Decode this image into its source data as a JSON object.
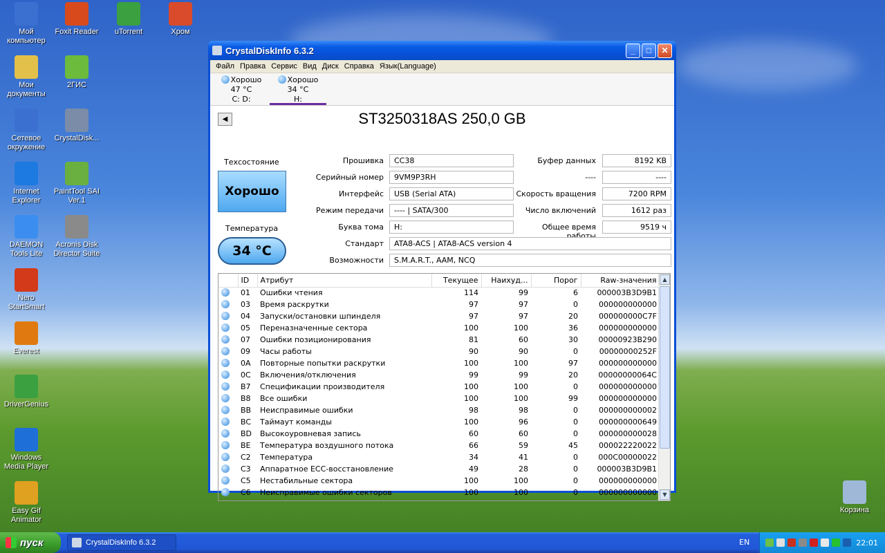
{
  "desktop": {
    "icons": [
      {
        "label": "Мой компьютер",
        "icon": "my-computer-icon",
        "color": "#3b6fd0"
      },
      {
        "label": "Мои документы",
        "icon": "my-documents-icon",
        "color": "#e3c04a"
      },
      {
        "label": "Сетевое окружение",
        "icon": "network-icon",
        "color": "#3b6fd0"
      },
      {
        "label": "Internet Explorer",
        "icon": "ie-icon",
        "color": "#1d7ae0"
      },
      {
        "label": "DAEMON Tools Lite",
        "icon": "daemon-tools-icon",
        "color": "#3b8ef0"
      },
      {
        "label": "Nero StartSmart",
        "icon": "nero-icon",
        "color": "#d23a1a"
      },
      {
        "label": "Everest",
        "icon": "everest-icon",
        "color": "#e07a10"
      },
      {
        "label": "DriverGenius",
        "icon": "driver-genius-icon",
        "color": "#3aa040"
      },
      {
        "label": "Windows Media Player",
        "icon": "media-player-icon",
        "color": "#1f6fd8"
      },
      {
        "label": "Easy Gif Animator",
        "icon": "gif-animator-icon",
        "color": "#e0a020"
      },
      {
        "label": "Foxit Reader",
        "icon": "foxit-icon",
        "color": "#d84a1c"
      },
      {
        "label": "2ГИС",
        "icon": "2gis-icon",
        "color": "#6cbb3c"
      },
      {
        "label": "CrystalDisk...",
        "icon": "crystaldisk-icon",
        "color": "#7a8ca8"
      },
      {
        "label": "PaintTool SAI Ver.1",
        "icon": "painttool-icon",
        "color": "#6ab040"
      },
      {
        "label": "Acronis Disk Director Suite",
        "icon": "acronis-icon",
        "color": "#8a8a8a"
      },
      {
        "label": "uTorrent",
        "icon": "utorrent-icon",
        "color": "#3aa040"
      },
      {
        "label": "Хром",
        "icon": "chrome-icon",
        "color": "#d94b2b"
      },
      {
        "label": "Корзина",
        "icon": "recycle-bin-icon",
        "color": "#9fb8d8"
      }
    ]
  },
  "window": {
    "title": "CrystalDiskInfo 6.3.2",
    "menu": [
      "Файл",
      "Правка",
      "Сервис",
      "Вид",
      "Диск",
      "Справка",
      "Язык(Language)"
    ],
    "disk_tabs": [
      {
        "status": "Хорошо",
        "temp": "47 °C",
        "drive": "C: D:"
      },
      {
        "status": "Хорошо",
        "temp": "34 °C",
        "drive": "H:"
      }
    ],
    "model": "ST3250318AS 250,0 GB",
    "health_label": "Техсостояние",
    "health_value": "Хорошо",
    "temp_label": "Температура",
    "temp_value": "34 °C",
    "info_left": [
      {
        "label": "Прошивка",
        "value": "CC38"
      },
      {
        "label": "Серийный номер",
        "value": "9VM9P3RH"
      },
      {
        "label": "Интерфейс",
        "value": "USB (Serial ATA)"
      },
      {
        "label": "Режим передачи",
        "value": "---- | SATA/300"
      },
      {
        "label": "Буква тома",
        "value": "H:"
      }
    ],
    "info_right": [
      {
        "label": "Буфер данных",
        "value": "8192 KB"
      },
      {
        "label": "----",
        "value": "----"
      },
      {
        "label": "Скорость вращения",
        "value": "7200 RPM"
      },
      {
        "label": "Число включений",
        "value": "1612 раз"
      },
      {
        "label": "Общее время работы",
        "value": "9519 ч"
      }
    ],
    "standard_label": "Стандарт",
    "standard_value": "ATA8-ACS | ATA8-ACS version 4",
    "features_label": "Возможности",
    "features_value": "S.M.A.R.T., AAM, NCQ",
    "smart_headers": [
      "",
      "ID",
      "Атрибут",
      "Текущее",
      "Наихуд...",
      "Порог",
      "Raw-значения"
    ],
    "smart_rows": [
      [
        "01",
        "Ошибки чтения",
        "114",
        "99",
        "6",
        "000003B3D9B1"
      ],
      [
        "03",
        "Время раскрутки",
        "97",
        "97",
        "0",
        "000000000000"
      ],
      [
        "04",
        "Запуски/остановки шпинделя",
        "97",
        "97",
        "20",
        "000000000C7F"
      ],
      [
        "05",
        "Переназначенные сектора",
        "100",
        "100",
        "36",
        "000000000000"
      ],
      [
        "07",
        "Ошибки позиционирования",
        "81",
        "60",
        "30",
        "00000923B290"
      ],
      [
        "09",
        "Часы работы",
        "90",
        "90",
        "0",
        "00000000252F"
      ],
      [
        "0A",
        "Повторные попытки раскрутки",
        "100",
        "100",
        "97",
        "000000000000"
      ],
      [
        "0C",
        "Включения/отключения",
        "99",
        "99",
        "20",
        "00000000064C"
      ],
      [
        "B7",
        "Спецификации производителя",
        "100",
        "100",
        "0",
        "000000000000"
      ],
      [
        "B8",
        "Все ошибки",
        "100",
        "100",
        "99",
        "000000000000"
      ],
      [
        "BB",
        "Неисправимые ошибки",
        "98",
        "98",
        "0",
        "000000000002"
      ],
      [
        "BC",
        "Таймаут команды",
        "100",
        "96",
        "0",
        "000000000649"
      ],
      [
        "BD",
        "Высокоуровневая запись",
        "60",
        "60",
        "0",
        "000000000028"
      ],
      [
        "BE",
        "Температура воздушного потока",
        "66",
        "59",
        "45",
        "000022220022"
      ],
      [
        "C2",
        "Температура",
        "34",
        "41",
        "0",
        "000C00000022"
      ],
      [
        "C3",
        "Аппаратное ECC-восстановление",
        "49",
        "28",
        "0",
        "000003B3D9B1"
      ],
      [
        "C5",
        "Нестабильные сектора",
        "100",
        "100",
        "0",
        "000000000000"
      ],
      [
        "C6",
        "Неисправимые ошибки секторов",
        "100",
        "100",
        "0",
        "000000000000"
      ]
    ]
  },
  "taskbar": {
    "start_label": "пуск",
    "task_label": "CrystalDiskInfo 6.3.2",
    "lang": "EN",
    "clock": "22:01"
  }
}
